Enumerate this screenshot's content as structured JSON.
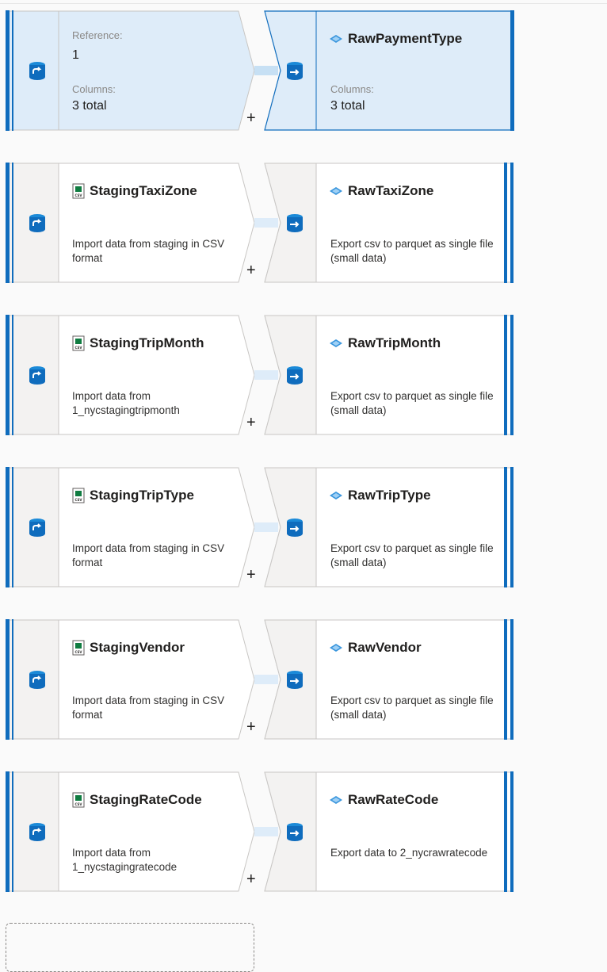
{
  "rows": [
    {
      "selected": true,
      "source": {
        "ref_label": "Reference:",
        "ref_value": "1",
        "cols_label": "Columns:",
        "cols_value": "3 total"
      },
      "sink": {
        "name": "RawPaymentType",
        "cols_label": "Columns:",
        "cols_value": "3 total"
      },
      "add_label": "+"
    },
    {
      "source": {
        "name": "StagingTaxiZone",
        "desc": "Import data from staging in CSV format"
      },
      "sink": {
        "name": "RawTaxiZone",
        "desc": "Export csv to parquet as single file (small data)"
      },
      "add_label": "+"
    },
    {
      "source": {
        "name": "StagingTripMonth",
        "desc": "Import data from 1_nycstagingtripmonth"
      },
      "sink": {
        "name": "RawTripMonth",
        "desc": "Export csv to parquet as single file (small data)"
      },
      "add_label": "+"
    },
    {
      "source": {
        "name": "StagingTripType",
        "desc": "Import data from staging in CSV format"
      },
      "sink": {
        "name": "RawTripType",
        "desc": "Export csv to parquet as single file (small data)"
      },
      "add_label": "+"
    },
    {
      "source": {
        "name": "StagingVendor",
        "desc": "Import data from staging in CSV format"
      },
      "sink": {
        "name": "RawVendor",
        "desc": "Export csv to parquet as single file (small data)"
      },
      "add_label": "+"
    },
    {
      "source": {
        "name": "StagingRateCode",
        "desc": "Import data from 1_nycstagingratecode"
      },
      "sink": {
        "name": "RawRateCode",
        "desc": "Export data to 2_nycrawratecode"
      },
      "add_label": "+"
    }
  ],
  "colors": {
    "accent": "#0f6cbd",
    "selected_bg": "#deecf9",
    "selected_border": "#0f6cbd",
    "card_bg": "#ffffff",
    "side_bg": "#f3f2f1"
  },
  "icons": {
    "source_side": "transform-db-icon",
    "sink_side": "export-db-icon",
    "csv": "csv-file-icon",
    "parquet": "parquet-icon"
  }
}
